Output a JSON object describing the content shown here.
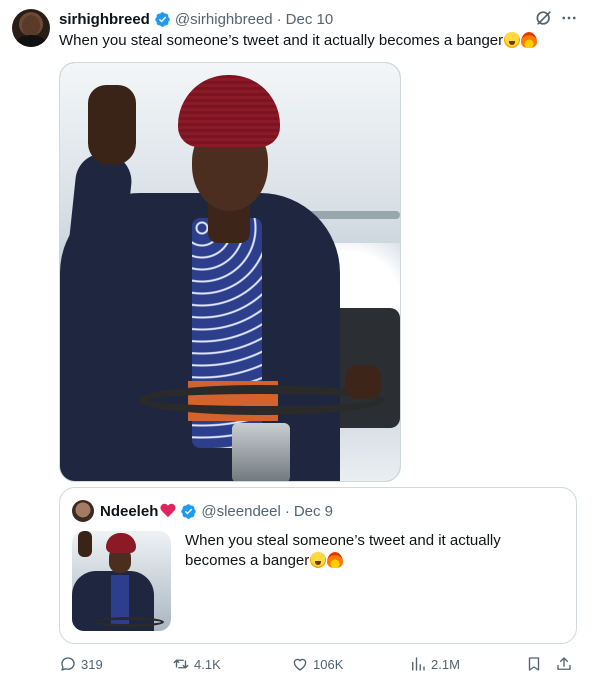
{
  "tweet": {
    "author": {
      "display_name": "sirhighbreed",
      "handle": "@sirhighbreed",
      "verified": true
    },
    "separator": "·",
    "date": "Dec 10",
    "text": "When you steal someone’s tweet and it actually becomes a banger",
    "text_emojis": [
      "loudly-crying-face",
      "fire"
    ]
  },
  "quoted_tweet": {
    "author": {
      "display_name": "Ndeeleh",
      "name_emoji": "red-heart",
      "handle": "@sleendeel",
      "verified": true
    },
    "separator": "·",
    "date": "Dec 9",
    "text": "When you steal someone’s tweet and it actually becomes a banger",
    "text_emojis": [
      "loudly-crying-face",
      "fire"
    ]
  },
  "actions": {
    "replies": "319",
    "retweets": "4.1K",
    "likes": "106K",
    "views": "2.1M"
  },
  "colors": {
    "text_primary": "#0f1419",
    "text_secondary": "#536471",
    "verified_blue": "#1d9bf0",
    "border": "#cfd9de"
  }
}
